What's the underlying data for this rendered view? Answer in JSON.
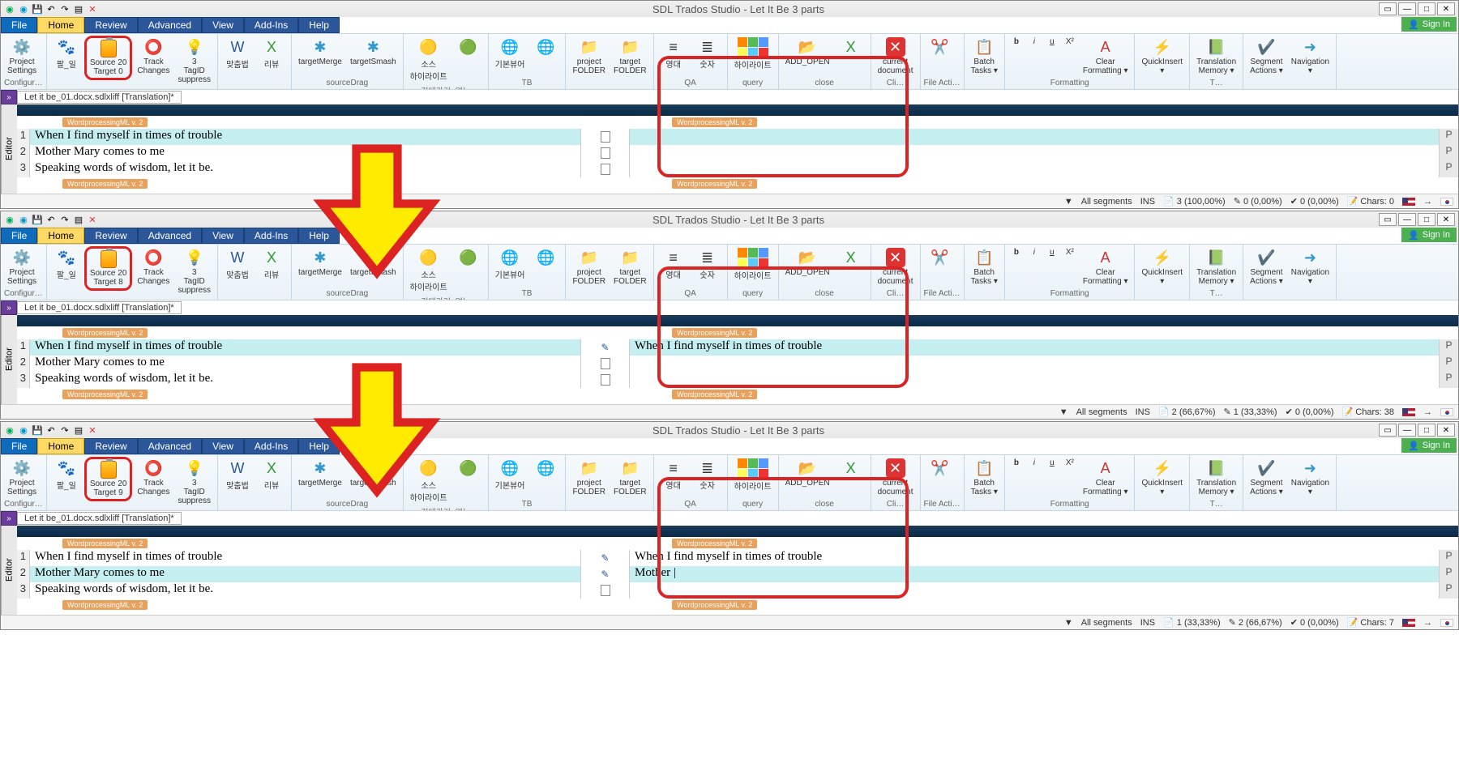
{
  "app_title": "SDL Trados Studio - Let It Be 3 parts",
  "tabs": {
    "file": "File",
    "home": "Home",
    "review": "Review",
    "advanced": "Advanced",
    "view": "View",
    "addins": "Add-Ins",
    "help": "Help"
  },
  "signin": "Sign In",
  "doc_tab": "Let it be_01.docx.sdlxliff [Translation]*",
  "side_label": "Editor",
  "tag_label": "WordprocessingML v. 2",
  "ribbon": {
    "project_settings": "Project\nSettings",
    "configur": "Configur…",
    "palil": "팔_일",
    "track_changes": "Track\nChanges",
    "tagid": "3\nTagID\nsuppress",
    "matchum": "맞춤법",
    "review": "리뷰",
    "target_merge": "targetMerge",
    "target_smash": "targetSmash",
    "source_drag": "sourceDrag",
    "sos1": "소스\n하이라이트",
    "sos2": "검대가리_없는",
    "basic_view": "기본뷰어",
    "tb": "TB",
    "proj_folder": "project\nFOLDER",
    "tgt_folder": "target\nFOLDER",
    "yeongdae": "영대",
    "sutja": "숫자",
    "qa": "QA",
    "haili": "하이라이트",
    "query": "query",
    "add_open": "ADD_OPEN",
    "cur_doc": "current\ndocument",
    "close": "close",
    "file_acti": "File Acti…",
    "cli": "Cli…",
    "batch": "Batch\nTasks ▾",
    "clear_fmt": "Clear\nFormatting ▾",
    "formatting": "Formatting",
    "quickinsert": "QuickInsert\n▾",
    "tm": "Translation\nMemory ▾",
    "t_group": "T…",
    "seg_actions": "Segment\nActions ▾",
    "navigation": "Navigation\n▾"
  },
  "panels": [
    {
      "wordcount": "Source 20\nTarget 0",
      "segments": [
        {
          "n": "1",
          "src": "When I find myself in times of trouble",
          "tgt": "",
          "status": "doc",
          "p": "P",
          "active": true
        },
        {
          "n": "2",
          "src": "Mother Mary comes to me",
          "tgt": "",
          "status": "doc",
          "p": "P"
        },
        {
          "n": "3",
          "src": "Speaking words of wisdom, let it be.",
          "tgt": "",
          "status": "doc",
          "p": "P"
        }
      ],
      "status": {
        "filter": "All segments",
        "ins": "INS",
        "a": "3 (100,00%)",
        "b": "0 (0,00%)",
        "c": "0 (0,00%)",
        "chars": "Chars: 0"
      }
    },
    {
      "wordcount": "Source 20\nTarget 8",
      "segments": [
        {
          "n": "1",
          "src": "When I find myself in times of trouble",
          "tgt": "When I find myself in times of trouble",
          "status": "pen",
          "p": "P",
          "active": true
        },
        {
          "n": "2",
          "src": "Mother Mary comes to me",
          "tgt": "",
          "status": "doc",
          "p": "P"
        },
        {
          "n": "3",
          "src": "Speaking words of wisdom, let it be.",
          "tgt": "",
          "status": "doc",
          "p": "P"
        }
      ],
      "status": {
        "filter": "All segments",
        "ins": "INS",
        "a": "2 (66,67%)",
        "b": "1 (33,33%)",
        "c": "0 (0,00%)",
        "chars": "Chars: 38"
      }
    },
    {
      "wordcount": "Source 20\nTarget 9",
      "segments": [
        {
          "n": "1",
          "src": "When I find myself in times of trouble",
          "tgt": "When I find myself in times of trouble",
          "status": "pen",
          "p": "P"
        },
        {
          "n": "2",
          "src": "Mother Mary comes to me",
          "tgt": "Mother |",
          "status": "pen",
          "p": "P",
          "active": true
        },
        {
          "n": "3",
          "src": "Speaking words of wisdom, let it be.",
          "tgt": "",
          "status": "doc",
          "p": "P"
        }
      ],
      "status": {
        "filter": "All segments",
        "ins": "INS",
        "a": "1 (33,33%)",
        "b": "2 (66,67%)",
        "c": "0 (0,00%)",
        "chars": "Chars: 7"
      }
    }
  ]
}
